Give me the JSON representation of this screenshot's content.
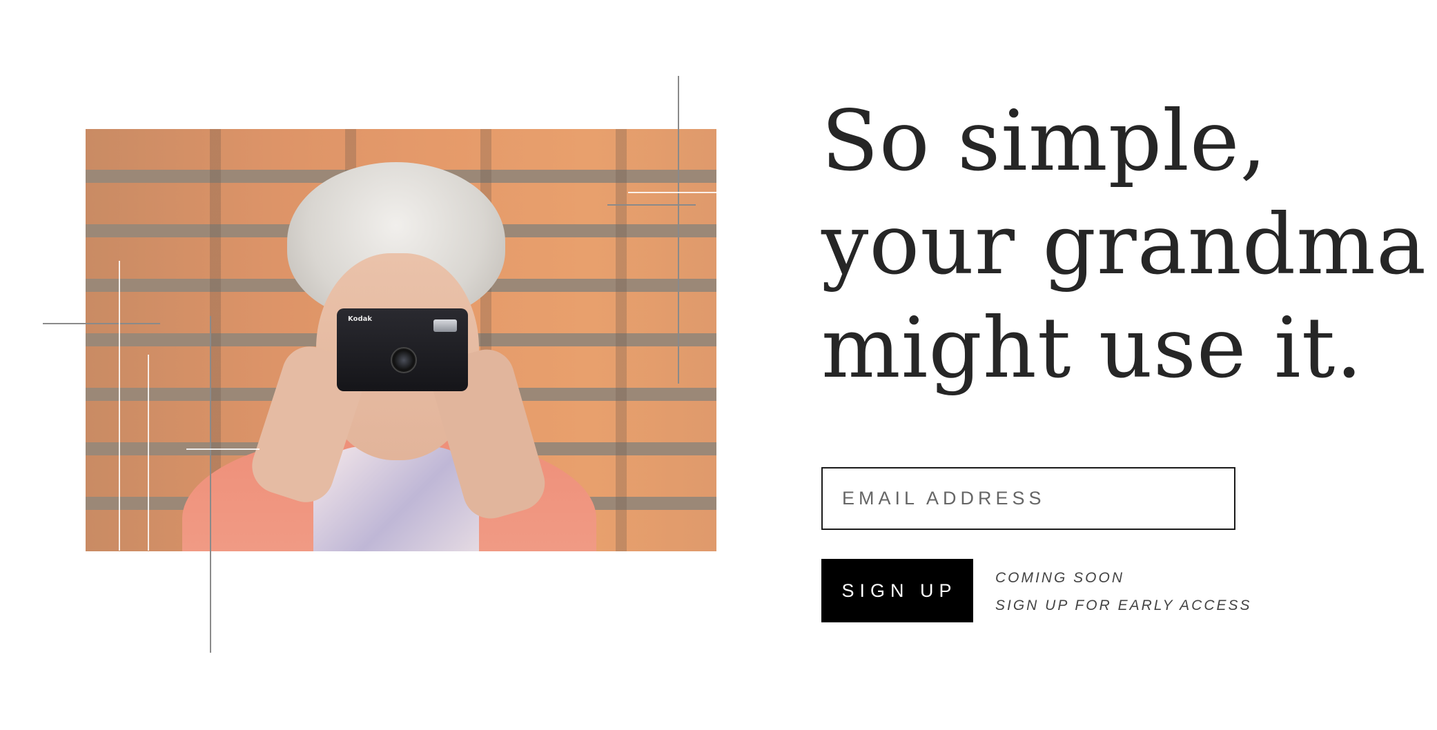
{
  "hero": {
    "headline_lines": [
      "So simple,",
      "your grandma",
      "might use it."
    ],
    "image": {
      "subject": "grandma-with-camera",
      "camera_brand": "Kodak"
    }
  },
  "form": {
    "email_placeholder": "EMAIL ADDRESS",
    "email_value": "",
    "submit_label": "SIGN UP"
  },
  "notes": {
    "coming_soon": "COMING SOON",
    "early_access": "SIGN UP FOR EARLY ACCESS"
  },
  "colors": {
    "text": "#262626",
    "button_bg": "#000000",
    "button_text": "#ffffff",
    "border": "#1a1a1a",
    "background": "#ffffff"
  }
}
